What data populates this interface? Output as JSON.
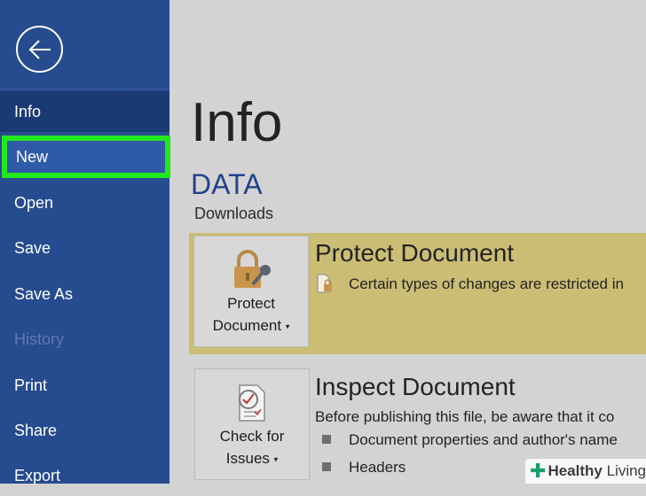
{
  "sidebar": {
    "items": [
      {
        "label": "Info"
      },
      {
        "label": "New"
      },
      {
        "label": "Open"
      },
      {
        "label": "Save"
      },
      {
        "label": "Save As"
      },
      {
        "label": "History"
      },
      {
        "label": "Print"
      },
      {
        "label": "Share"
      },
      {
        "label": "Export"
      }
    ]
  },
  "main": {
    "title": "Info",
    "doc_name": "DATA",
    "doc_path": "Downloads",
    "protect": {
      "button_line1": "Protect",
      "button_line2": "Document",
      "title": "Protect Document",
      "description": "Certain types of changes are restricted in"
    },
    "inspect": {
      "button_line1": "Check for",
      "button_line2": "Issues",
      "title": "Inspect Document",
      "description": "Before publishing this file, be aware that it co",
      "bullets": [
        "Document properties and author's name",
        "Headers"
      ]
    }
  },
  "watermark": {
    "brand_bold": "Healthy",
    "brand_light": "Living"
  },
  "colors": {
    "sidebar": "#274b8f",
    "highlight": "#22e81c",
    "protect_band": "#cbbd74"
  }
}
